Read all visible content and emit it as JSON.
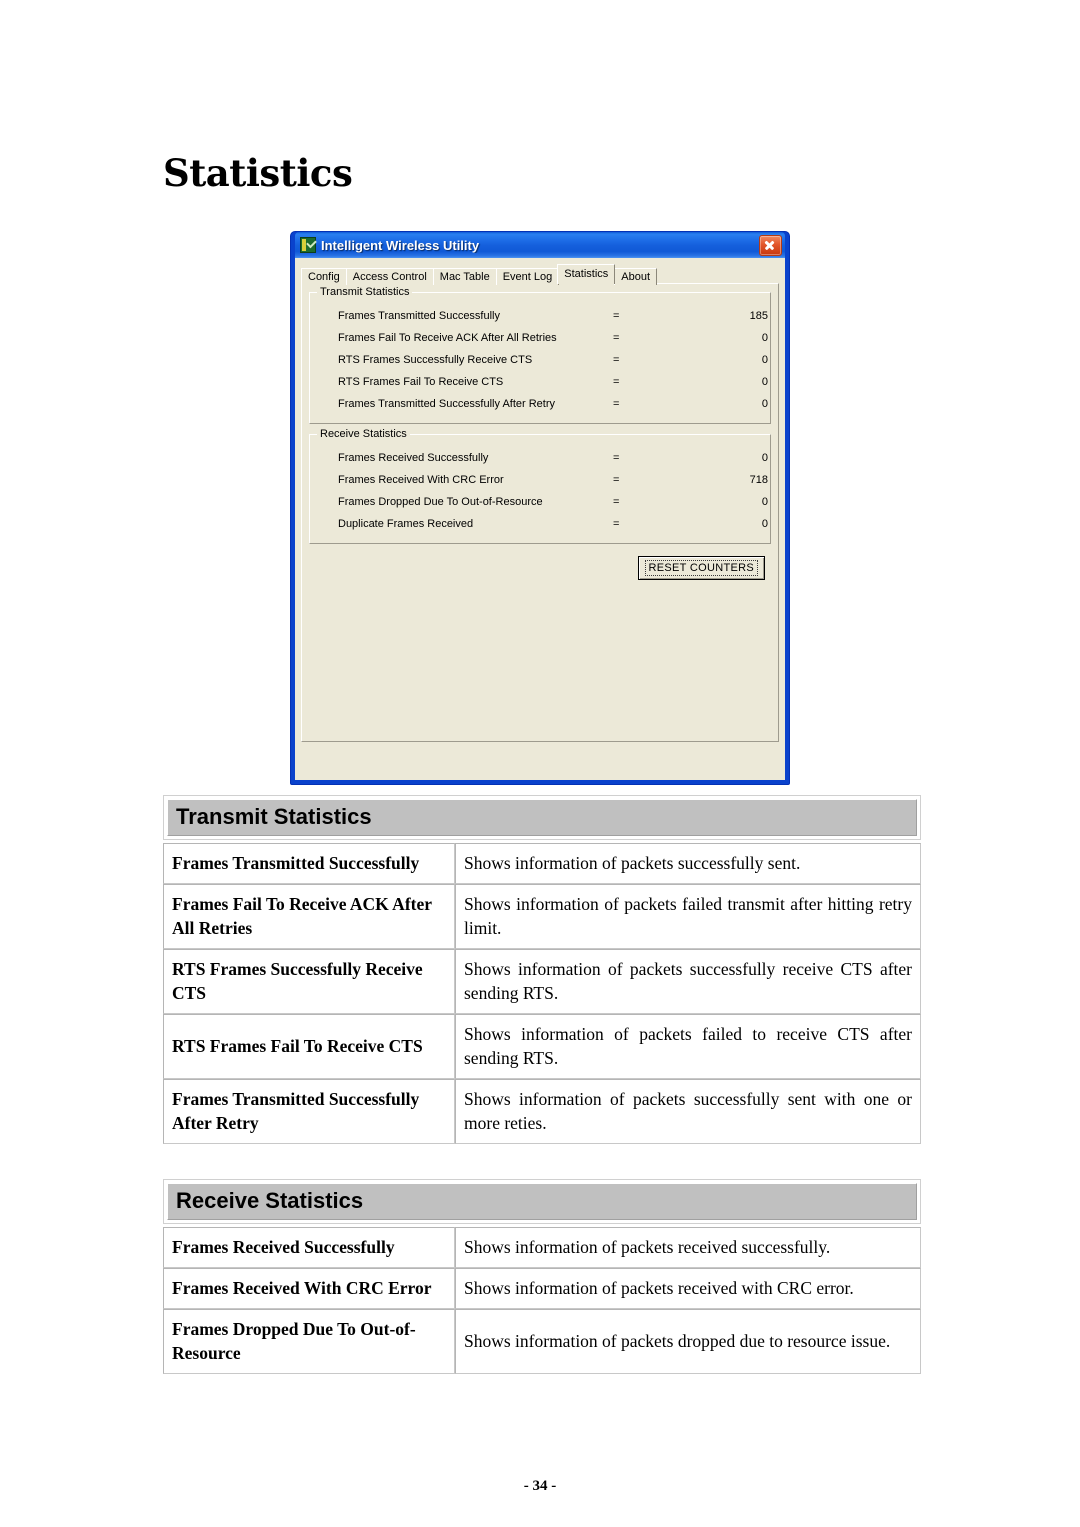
{
  "page": {
    "title": "Statistics",
    "footer": "- 34 -"
  },
  "window": {
    "title": "Intelligent Wireless Utility",
    "icon": "wireless-utility-icon",
    "close_label": "",
    "tabs": [
      {
        "label": "Config",
        "active": false
      },
      {
        "label": "Access Control",
        "active": false
      },
      {
        "label": "Mac Table",
        "active": false
      },
      {
        "label": "Event Log",
        "active": false
      },
      {
        "label": "Statistics",
        "active": true
      },
      {
        "label": "About",
        "active": false
      }
    ],
    "transmit_group": {
      "legend": "Transmit Statistics",
      "rows": [
        {
          "label": "Frames Transmitted Successfully",
          "eq": "=",
          "value": "185"
        },
        {
          "label": "Frames Fail To Receive ACK After All Retries",
          "eq": "=",
          "value": "0"
        },
        {
          "label": "RTS Frames Successfully Receive CTS",
          "eq": "=",
          "value": "0"
        },
        {
          "label": "RTS Frames Fail To Receive CTS",
          "eq": "=",
          "value": "0"
        },
        {
          "label": "Frames Transmitted Successfully After Retry",
          "eq": "=",
          "value": "0"
        }
      ]
    },
    "receive_group": {
      "legend": "Receive Statistics",
      "rows": [
        {
          "label": "Frames Received Successfully",
          "eq": "=",
          "value": "0"
        },
        {
          "label": "Frames Received With CRC Error",
          "eq": "=",
          "value": "718"
        },
        {
          "label": "Frames Dropped Due To Out-of-Resource",
          "eq": "=",
          "value": "0"
        },
        {
          "label": "Duplicate Frames Received",
          "eq": "=",
          "value": "0"
        }
      ]
    },
    "reset_button": "RESET COUNTERS"
  },
  "tables": {
    "transmit": {
      "heading": "Transmit Statistics",
      "rows": [
        {
          "term": "Frames Transmitted Successfully",
          "definition": "Shows information of packets successfully sent."
        },
        {
          "term": "Frames Fail To Receive ACK After All Retries",
          "definition": "Shows information of packets failed transmit after hitting retry limit."
        },
        {
          "term": "RTS Frames Successfully Receive CTS",
          "definition": "Shows information of packets successfully receive CTS after sending RTS."
        },
        {
          "term": "RTS Frames Fail To Receive CTS",
          "definition": "Shows information of packets failed to receive CTS after sending RTS."
        },
        {
          "term": "Frames Transmitted Successfully After Retry",
          "definition": "Shows information of packets successfully sent with one or more reties."
        }
      ]
    },
    "receive": {
      "heading": "Receive Statistics",
      "rows": [
        {
          "term": "Frames Received Successfully",
          "definition": "Shows information of packets received successfully."
        },
        {
          "term": "Frames Received With CRC Error",
          "definition": "Shows information of packets received with CRC error."
        },
        {
          "term": "Frames Dropped Due To Out-of-Resource",
          "definition": "Shows information of packets dropped due to resource issue."
        }
      ]
    }
  },
  "colors": {
    "title_bar": "#1560dd",
    "dialog_face": "#ece9d8",
    "section_header": "#c0c0c0",
    "close_button": "#c7380f"
  }
}
